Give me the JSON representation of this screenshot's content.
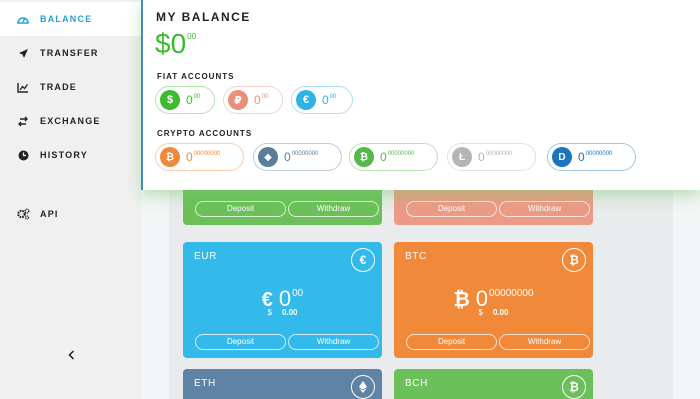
{
  "sidebar": {
    "items": [
      {
        "label": "BALANCE",
        "icon": "dashboard-icon",
        "active": true
      },
      {
        "label": "TRANSFER",
        "icon": "paper-plane-icon"
      },
      {
        "label": "TRADE",
        "icon": "line-chart-icon"
      },
      {
        "label": "EXCHANGE",
        "icon": "exchange-icon"
      },
      {
        "label": "HISTORY",
        "icon": "clock-icon"
      },
      {
        "label": "API",
        "icon": "gears-icon"
      }
    ],
    "collapse_icon": "chevron-left-icon"
  },
  "balance": {
    "title": "MY BALANCE",
    "currency_symbol": "$",
    "amount": "0",
    "decimals": "00",
    "fiat_label": "FIAT ACCOUNTS",
    "crypto_label": "CRYPTO ACCOUNTS",
    "fiat": [
      {
        "symbol": "$",
        "amount": "0",
        "decimals": "00",
        "color": "#3dbb2e",
        "icon": "dollar-icon"
      },
      {
        "symbol": "₽",
        "amount": "0",
        "decimals": "00",
        "color": "#e8907a",
        "icon": "ruble-icon"
      },
      {
        "symbol": "€",
        "amount": "0",
        "decimals": "00",
        "color": "#2fb3e6",
        "icon": "euro-icon"
      }
    ],
    "crypto": [
      {
        "symbol": "₿",
        "amount": "0",
        "decimals": "00000000",
        "color": "#f0883a",
        "icon": "bitcoin-icon"
      },
      {
        "symbol": "◆",
        "amount": "0",
        "decimals": "00000000",
        "color": "#5a7d9a",
        "icon": "ethereum-icon"
      },
      {
        "symbol": "₿",
        "amount": "0",
        "decimals": "00000000",
        "color": "#55b94a",
        "icon": "bitcoin-cash-icon"
      },
      {
        "symbol": "Ł",
        "amount": "0",
        "decimals": "00000000",
        "color": "#b5b5b5",
        "icon": "litecoin-icon"
      },
      {
        "symbol": "D",
        "amount": "0",
        "decimals": "00000000",
        "color": "#1c75bc",
        "icon": "dash-icon"
      }
    ]
  },
  "cards": {
    "deposit_label": "Deposit",
    "withdraw_label": "Withdraw",
    "top_left_color": "#6cc05a",
    "top_right_color": "#ec9a85",
    "eur": {
      "title": "EUR",
      "symbol": "€",
      "amount": "0",
      "decimals": "00",
      "usd_symbol": "$",
      "usd_value": "0.00",
      "color": "#33baeb"
    },
    "btc": {
      "title": "BTC",
      "symbol": "₿",
      "amount": "0",
      "decimals": "00000000",
      "usd_symbol": "$",
      "usd_value": "0.00",
      "color": "#f0893a"
    },
    "eth": {
      "title": "ETH",
      "color": "#5f83a5"
    },
    "bch": {
      "title": "BCH",
      "color": "#6cc05a"
    }
  }
}
